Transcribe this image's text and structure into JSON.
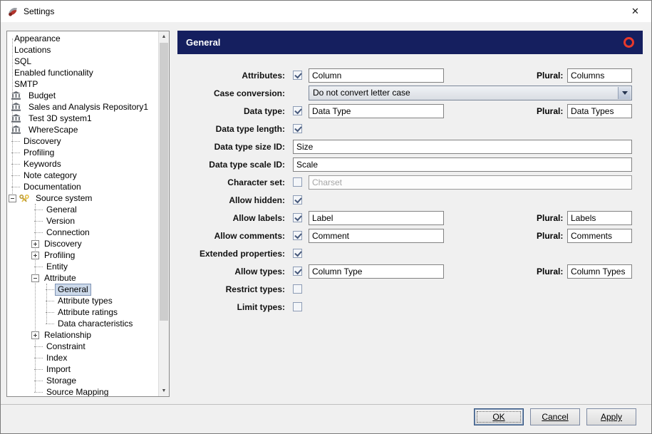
{
  "window": {
    "title": "Settings"
  },
  "icons": {
    "close": "✕",
    "scroll_up": "▲",
    "scroll_down": "▼"
  },
  "colors": {
    "header_bg": "#151f5f",
    "ring_red": "#e8392b",
    "selection_bg": "#ccd9ea",
    "checkbox_check": "#46587a"
  },
  "panel": {
    "title": "General"
  },
  "tree": {
    "items": [
      {
        "label": "Appearance",
        "level": 0,
        "prefix": "none",
        "icon": "none"
      },
      {
        "label": "Locations",
        "level": 0,
        "prefix": "none",
        "icon": "none"
      },
      {
        "label": "SQL",
        "level": 0,
        "prefix": "none",
        "icon": "none"
      },
      {
        "label": "Enabled functionality",
        "level": 0,
        "prefix": "none",
        "icon": "none"
      },
      {
        "label": "SMTP",
        "level": 0,
        "prefix": "none",
        "icon": "none"
      },
      {
        "label": "Budget",
        "level": 0,
        "prefix": "none",
        "icon": "bank"
      },
      {
        "label": "Sales and Analysis Repository1",
        "level": 0,
        "prefix": "none",
        "icon": "bank"
      },
      {
        "label": "Test 3D system1",
        "level": 0,
        "prefix": "none",
        "icon": "bank"
      },
      {
        "label": "WhereScape",
        "level": 0,
        "prefix": "none",
        "icon": "bank"
      },
      {
        "label": "Discovery",
        "level": 0,
        "prefix": "dash",
        "icon": "none"
      },
      {
        "label": "Profiling",
        "level": 0,
        "prefix": "dash",
        "icon": "none"
      },
      {
        "label": "Keywords",
        "level": 0,
        "prefix": "dash",
        "icon": "none"
      },
      {
        "label": "Note category",
        "level": 0,
        "prefix": "dash",
        "icon": "none"
      },
      {
        "label": "Documentation",
        "level": 0,
        "prefix": "dash",
        "icon": "none"
      },
      {
        "label": "Source system",
        "level": 0,
        "prefix": "minus",
        "icon": "keys"
      },
      {
        "label": "General",
        "level": 1,
        "prefix": "dash",
        "icon": "none"
      },
      {
        "label": "Version",
        "level": 1,
        "prefix": "dash",
        "icon": "none"
      },
      {
        "label": "Connection",
        "level": 1,
        "prefix": "dash",
        "icon": "none"
      },
      {
        "label": "Discovery",
        "level": 1,
        "prefix": "plus",
        "icon": "none"
      },
      {
        "label": "Profiling",
        "level": 1,
        "prefix": "plus",
        "icon": "none"
      },
      {
        "label": "Entity",
        "level": 1,
        "prefix": "dash",
        "icon": "none"
      },
      {
        "label": "Attribute",
        "level": 1,
        "prefix": "minus",
        "icon": "none"
      },
      {
        "label": "General",
        "level": 2,
        "prefix": "dash",
        "icon": "none",
        "selected": true
      },
      {
        "label": "Attribute types",
        "level": 2,
        "prefix": "dash",
        "icon": "none"
      },
      {
        "label": "Attribute ratings",
        "level": 2,
        "prefix": "dash",
        "icon": "none"
      },
      {
        "label": "Data characteristics",
        "level": 2,
        "prefix": "dash",
        "icon": "none"
      },
      {
        "label": "Relationship",
        "level": 1,
        "prefix": "plus",
        "icon": "none"
      },
      {
        "label": "Constraint",
        "level": 1,
        "prefix": "dash",
        "icon": "none"
      },
      {
        "label": "Index",
        "level": 1,
        "prefix": "dash",
        "icon": "none"
      },
      {
        "label": "Import",
        "level": 1,
        "prefix": "dash",
        "icon": "none"
      },
      {
        "label": "Storage",
        "level": 1,
        "prefix": "dash",
        "icon": "none"
      },
      {
        "label": "Source Mapping",
        "level": 1,
        "prefix": "dash",
        "icon": "none"
      }
    ]
  },
  "form": {
    "plural_label": "Plural:",
    "rows": [
      {
        "label": "Attributes:",
        "checkbox": "checked",
        "type": "text-plural",
        "value": "Column",
        "plural_value": "Columns"
      },
      {
        "label": "Case conversion:",
        "checkbox": "none",
        "type": "dropdown",
        "value": "Do not convert letter case"
      },
      {
        "label": "Data type:",
        "checkbox": "checked",
        "type": "text-plural",
        "value": "Data Type",
        "plural_value": "Data Types"
      },
      {
        "label": "Data type length:",
        "checkbox": "checked",
        "type": "check-only"
      },
      {
        "label": "Data type size ID:",
        "checkbox": "none",
        "type": "wide-text",
        "value": "Size"
      },
      {
        "label": "Data type scale ID:",
        "checkbox": "none",
        "type": "wide-text",
        "value": "Scale"
      },
      {
        "label": "Character set:",
        "checkbox": "unchecked",
        "type": "disabled-text",
        "value": "Charset"
      },
      {
        "label": "Allow hidden:",
        "checkbox": "checked",
        "type": "check-only"
      },
      {
        "label": "Allow labels:",
        "checkbox": "checked",
        "type": "text-plural",
        "value": "Label",
        "plural_value": "Labels"
      },
      {
        "label": "Allow comments:",
        "checkbox": "checked",
        "type": "text-plural",
        "value": "Comment",
        "plural_value": "Comments"
      },
      {
        "label": "Extended properties:",
        "checkbox": "checked",
        "type": "check-only"
      },
      {
        "label": "Allow types:",
        "checkbox": "checked",
        "type": "text-plural",
        "value": "Column Type",
        "plural_value": "Column Types"
      },
      {
        "label": "Restrict types:",
        "checkbox": "unchecked",
        "type": "check-only"
      },
      {
        "label": "Limit types:",
        "checkbox": "unchecked",
        "type": "check-only"
      }
    ]
  },
  "buttons": [
    {
      "label": "OK",
      "default": true
    },
    {
      "label": "Cancel"
    },
    {
      "label": "Apply"
    }
  ]
}
